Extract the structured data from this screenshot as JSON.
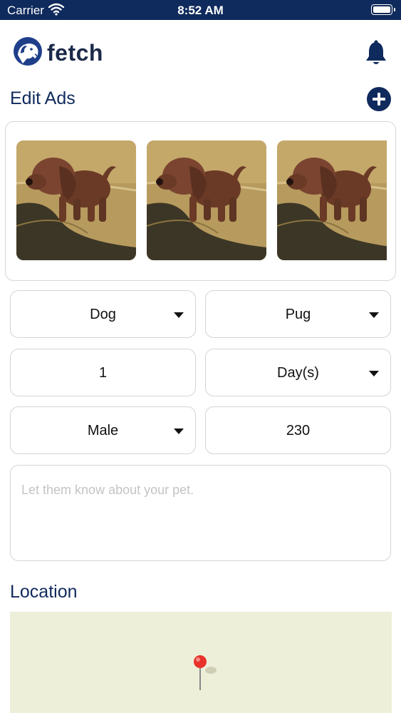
{
  "status_bar": {
    "carrier": "Carrier",
    "time": "8:52 AM",
    "icons": [
      "wifi-icon",
      "battery-icon"
    ]
  },
  "header": {
    "logo_text": "fetch",
    "logo_icon": "dog-logo-icon",
    "notification_icon": "bell-icon"
  },
  "edit_ads": {
    "title": "Edit Ads",
    "add_icon": "plus-circle-icon"
  },
  "photos": [
    {
      "label": "puppy photo 1"
    },
    {
      "label": "puppy photo 2"
    },
    {
      "label": "puppy photo 3"
    }
  ],
  "form": {
    "animal_type": "Dog",
    "breed": "Pug",
    "age_value": "1",
    "age_unit": "Day(s)",
    "gender": "Male",
    "price": "230",
    "description_placeholder": "Let them know about your pet."
  },
  "location": {
    "title": "Location",
    "pin_icon": "map-pin-icon"
  },
  "colors": {
    "brand_navy": "#0f2a5c",
    "map_background": "#eeefd9",
    "pin_red": "#e8322b"
  }
}
